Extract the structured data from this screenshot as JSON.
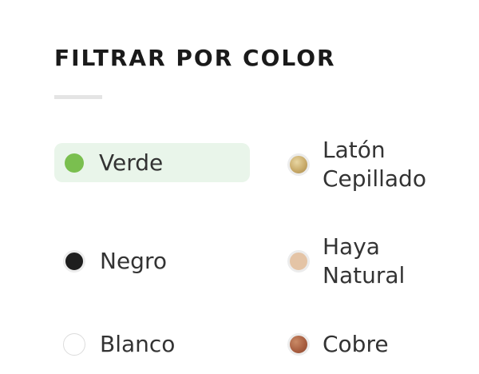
{
  "filter": {
    "title": "FILTRAR POR COLOR",
    "colors": [
      {
        "label": "Verde",
        "swatch": "#7abf4f",
        "selected": true,
        "highlight": "#e9f5ea"
      },
      {
        "label": "Latón\nCepillado",
        "swatch": "#c9ab6a",
        "selected": false
      },
      {
        "label": "Negro",
        "swatch": "#1e1e1e",
        "selected": false
      },
      {
        "label": "Haya\nNatural",
        "swatch": "#e4c4a6",
        "selected": false
      },
      {
        "label": "Blanco",
        "swatch": "#ffffff",
        "selected": false
      },
      {
        "label": "Cobre",
        "swatch": "#a65c3e",
        "selected": false
      }
    ]
  }
}
